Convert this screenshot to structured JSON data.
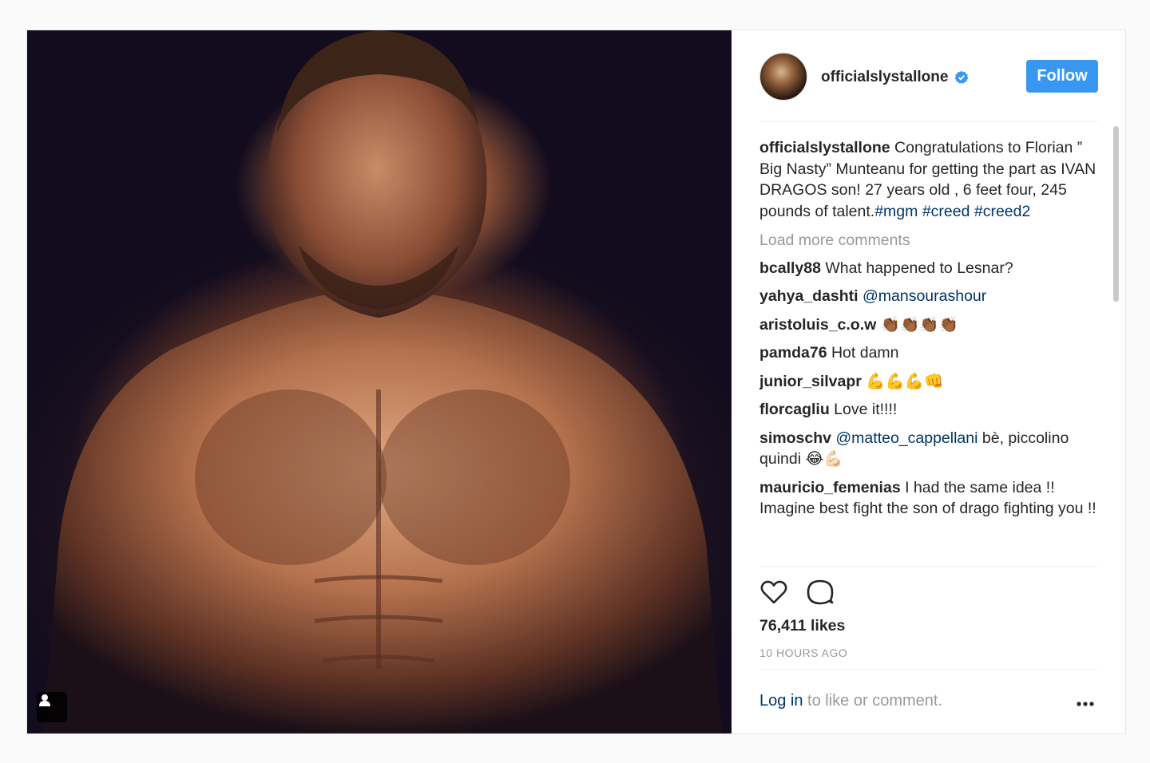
{
  "post": {
    "username": "officialslystallone",
    "follow_label": "Follow",
    "caption": {
      "username": "officialslystallone",
      "text": " Congratulations to Florian ” Big Nasty” Munteanu for getting the part as IVAN DRAGOS son! 27 years old , 6 feet four, 245 pounds of talent.",
      "hashtags": [
        "#mgm",
        "#creed",
        "#creed2"
      ]
    },
    "load_more_label": "Load more comments",
    "comments": [
      {
        "user": "bcally88",
        "text": " What happened to Lesnar?"
      },
      {
        "user": "yahya_dashti",
        "mention": " @mansourashour",
        "text": ""
      },
      {
        "user": "aristoluis_c.o.w",
        "text": " 👏🏾👏🏾👏🏾👏🏾"
      },
      {
        "user": "pamda76",
        "text": " Hot damn"
      },
      {
        "user": "junior_silvapr",
        "text": " 💪💪💪👊"
      },
      {
        "user": "florcagliu",
        "text": " Love it!!!!"
      },
      {
        "user": "simoschv",
        "mention": " @matteo_cappellani",
        "text": " bè, piccolino quindi 😂💪🏻"
      },
      {
        "user": "mauricio_femenias",
        "text": " I had the same idea !! Imagine best fight the son of drago fighting you !!"
      }
    ],
    "likes": "76,411 likes",
    "timestamp": "10 HOURS AGO",
    "login_link": "Log in",
    "login_rest": " to like or comment.",
    "icons": {
      "verified": "verified-badge-icon",
      "like": "heart-icon",
      "comment": "comment-bubble-icon",
      "more": "more-options-icon",
      "tagged": "user-tag-icon"
    },
    "colors": {
      "follow_bg": "#3897f0",
      "link": "#003569",
      "muted": "#999999"
    }
  }
}
